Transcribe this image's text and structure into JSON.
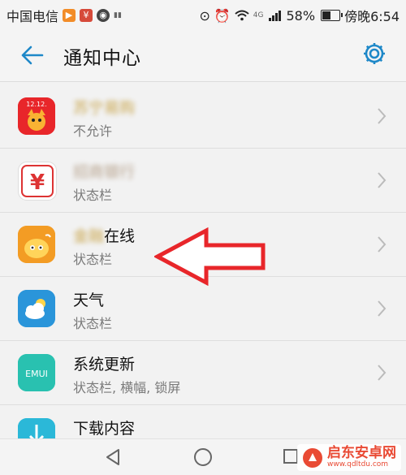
{
  "status_bar": {
    "carrier": "中国电信",
    "small_badge": "4G",
    "battery_percent": "58%",
    "battery_level": 0.58,
    "time": "傍晚6:54",
    "signal": "4G"
  },
  "header": {
    "title": "通知中心"
  },
  "apps": [
    {
      "name": "苏宁易购",
      "sub": "不允许",
      "icon": "suning-icon"
    },
    {
      "name": "招商银行",
      "sub": "状态栏",
      "icon": "yen-icon"
    },
    {
      "name": "在线",
      "name_prefix": "金融",
      "sub": "状态栏",
      "icon": "bird-icon"
    },
    {
      "name": "天气",
      "sub": "状态栏",
      "icon": "weather-icon"
    },
    {
      "name": "系统更新",
      "sub": "状态栏, 横幅, 锁屏",
      "icon": "emui-icon"
    },
    {
      "name": "下载内容",
      "sub": "",
      "icon": "download-icon"
    }
  ],
  "icon_labels": {
    "suning_date": "12.12.",
    "yen": "¥",
    "emui": "EMUI"
  },
  "colors": {
    "accent": "#1e88c8",
    "arrow": "#e8262a",
    "watermark": "#e94a34"
  },
  "watermark": {
    "title": "启东安卓网",
    "url": "www.qdltdu.com"
  }
}
